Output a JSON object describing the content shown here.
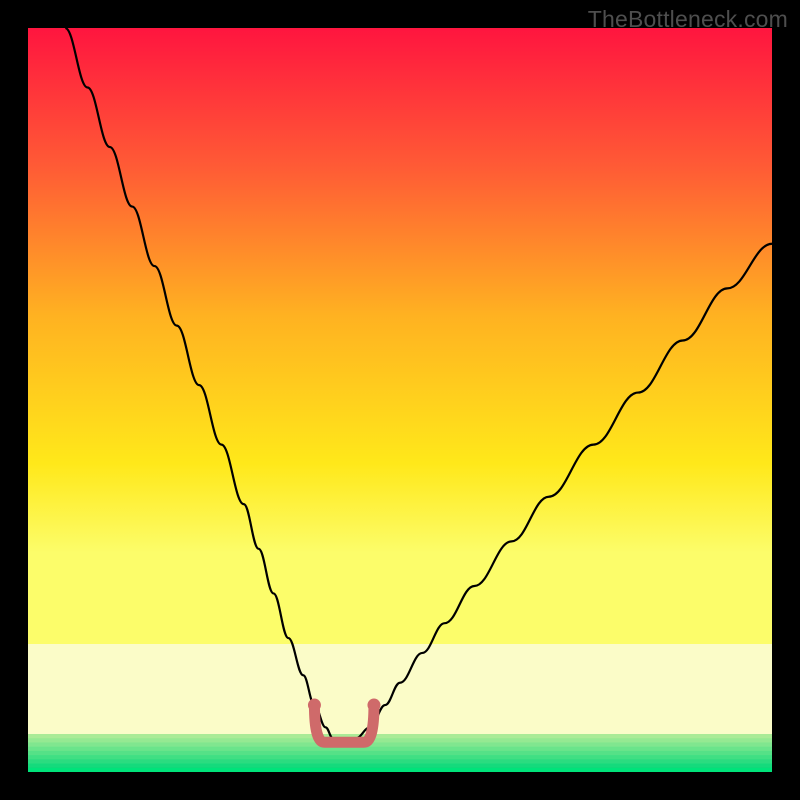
{
  "watermark": "TheBottleneck.com",
  "colors": {
    "frame": "#000000",
    "gradient_top": "#ff153f",
    "gradient_mid1": "#ff5c35",
    "gradient_mid2": "#ffb221",
    "gradient_mid3": "#ffe81a",
    "gradient_mid4": "#fcfd6a",
    "gradient_bottom": "#00e37a",
    "band_pale": "#fbfcc8",
    "curve": "#000000",
    "marker": "#cf6a6a"
  },
  "chart_data": {
    "type": "line",
    "title": "",
    "xlabel": "",
    "ylabel": "",
    "xlim": [
      0,
      100
    ],
    "ylim": [
      0,
      100
    ],
    "series": [
      {
        "name": "bottleneck-curve",
        "x": [
          5,
          8,
          11,
          14,
          17,
          20,
          23,
          26,
          29,
          31,
          33,
          35,
          37,
          38.5,
          40,
          41,
          42,
          43,
          44,
          46,
          48,
          50,
          53,
          56,
          60,
          65,
          70,
          76,
          82,
          88,
          94,
          100
        ],
        "y": [
          100,
          92,
          84,
          76,
          68,
          60,
          52,
          44,
          36,
          30,
          24,
          18,
          13,
          9,
          6,
          4.5,
          4,
          4,
          4.5,
          6,
          9,
          12,
          16,
          20,
          25,
          31,
          37,
          44,
          51,
          58,
          65,
          71
        ]
      }
    ],
    "annotations": [
      {
        "name": "minimum-marker",
        "x_start": 38.5,
        "x_end": 46.5,
        "y": 4
      }
    ]
  }
}
